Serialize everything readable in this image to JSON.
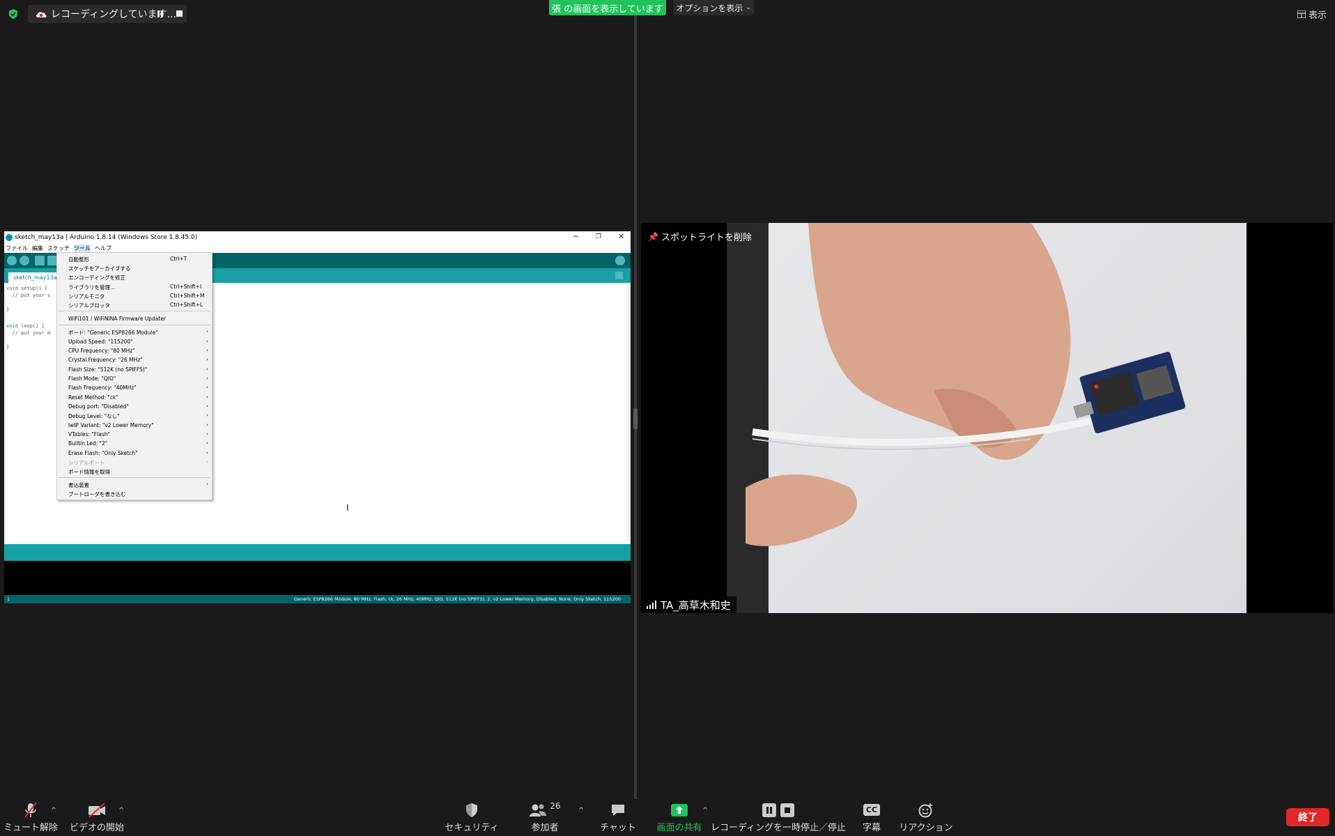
{
  "topbar": {
    "recording_label": "レコーディングしています...",
    "share_banner": "張 の画面を表示しています",
    "options_label": "オプションを表示",
    "view_label": "表示"
  },
  "arduino": {
    "title": "sketch_may13a | Arduino 1.8.14 (Windows Store 1.8.45.0)",
    "menus": [
      "ファイル",
      "編集",
      "スケッチ",
      "ツール",
      "ヘルプ"
    ],
    "tab_name": "sketch_may13a",
    "code": [
      {
        "kw": "void",
        "rest": " setup() {"
      },
      {
        "kw": "",
        "rest": "  // put your s"
      },
      {
        "kw": "",
        "rest": ""
      },
      {
        "kw": "",
        "rest": "}"
      },
      {
        "kw": "",
        "rest": ""
      },
      {
        "kw": "void",
        "rest": " loop() {"
      },
      {
        "kw": "",
        "rest": "  // put your m"
      },
      {
        "kw": "",
        "rest": ""
      },
      {
        "kw": "",
        "rest": "}"
      }
    ],
    "footer_line": "1",
    "footer_board": "Generic ESP8266 Module, 80 MHz, Flash, ck, 26 MHz, 40MHz, QIO, 512K (no SPIFFS), 2, v2 Lower Memory, Disabled, None, Only Sketch, 115200"
  },
  "tools_menu": {
    "items": [
      {
        "label": "自動整形",
        "shortcut": "Ctrl+T",
        "arrow": false,
        "disabled": false
      },
      {
        "label": "スケッチをアーカイブする",
        "shortcut": "",
        "arrow": false,
        "disabled": false
      },
      {
        "label": "エンコーディングを修正",
        "shortcut": "",
        "arrow": false,
        "disabled": false
      },
      {
        "label": "ライブラリを管理...",
        "shortcut": "Ctrl+Shift+I",
        "arrow": false,
        "disabled": false
      },
      {
        "label": "シリアルモニタ",
        "shortcut": "Ctrl+Shift+M",
        "arrow": false,
        "disabled": false
      },
      {
        "label": "シリアルプロッタ",
        "shortcut": "Ctrl+Shift+L",
        "arrow": false,
        "disabled": false
      },
      {
        "label": "WiFi101 / WiFiNINA Firmware Updater",
        "shortcut": "",
        "arrow": false,
        "disabled": false
      },
      {
        "label": "ボード: \"Generic ESP8266 Module\"",
        "shortcut": "",
        "arrow": true,
        "disabled": false
      },
      {
        "label": "Upload Speed: \"115200\"",
        "shortcut": "",
        "arrow": true,
        "disabled": false
      },
      {
        "label": "CPU Frequency: \"80 MHz\"",
        "shortcut": "",
        "arrow": true,
        "disabled": false
      },
      {
        "label": "Crystal Frequency: \"26 MHz\"",
        "shortcut": "",
        "arrow": true,
        "disabled": false
      },
      {
        "label": "Flash Size: \"512K (no SPIFFS)\"",
        "shortcut": "",
        "arrow": true,
        "disabled": false
      },
      {
        "label": "Flash Mode: \"QIO\"",
        "shortcut": "",
        "arrow": true,
        "disabled": false
      },
      {
        "label": "Flash Frequency: \"40MHz\"",
        "shortcut": "",
        "arrow": true,
        "disabled": false
      },
      {
        "label": "Reset Method: \"ck\"",
        "shortcut": "",
        "arrow": true,
        "disabled": false
      },
      {
        "label": "Debug port: \"Disabled\"",
        "shortcut": "",
        "arrow": true,
        "disabled": false
      },
      {
        "label": "Debug Level: \"なし\"",
        "shortcut": "",
        "arrow": true,
        "disabled": false
      },
      {
        "label": "lwIP Variant: \"v2 Lower Memory\"",
        "shortcut": "",
        "arrow": true,
        "disabled": false
      },
      {
        "label": "VTables: \"Flash\"",
        "shortcut": "",
        "arrow": true,
        "disabled": false
      },
      {
        "label": "Builtin Led: \"2\"",
        "shortcut": "",
        "arrow": true,
        "disabled": false
      },
      {
        "label": "Erase Flash: \"Only Sketch\"",
        "shortcut": "",
        "arrow": true,
        "disabled": false
      },
      {
        "label": "シリアルポート",
        "shortcut": "",
        "arrow": true,
        "disabled": true
      },
      {
        "label": "ボード情報を取得",
        "shortcut": "",
        "arrow": false,
        "disabled": false
      },
      {
        "label": "書込装置",
        "shortcut": "",
        "arrow": true,
        "disabled": false
      },
      {
        "label": "ブートローダを書き込む",
        "shortcut": "",
        "arrow": false,
        "disabled": false
      }
    ]
  },
  "video": {
    "spotlight_label": "スポットライトを削除",
    "participant_name": "TA_高草木和史"
  },
  "toolbar": {
    "mute_label": "ミュート解除",
    "video_label": "ビデオの開始",
    "security_label": "セキュリティ",
    "participants_label": "参加者",
    "participants_count": "26",
    "chat_label": "チャット",
    "share_label": "画面の共有",
    "recording_label": "レコーディングを一時停止／停止",
    "cc_label": "字幕",
    "cc_icon_text": "CC",
    "reaction_label": "リアクション",
    "end_label": "終了"
  },
  "colors": {
    "zoom_green": "#21c35b",
    "end_red": "#e02828",
    "arduino_teal_dark": "#006468",
    "arduino_teal": "#17a1a5"
  }
}
